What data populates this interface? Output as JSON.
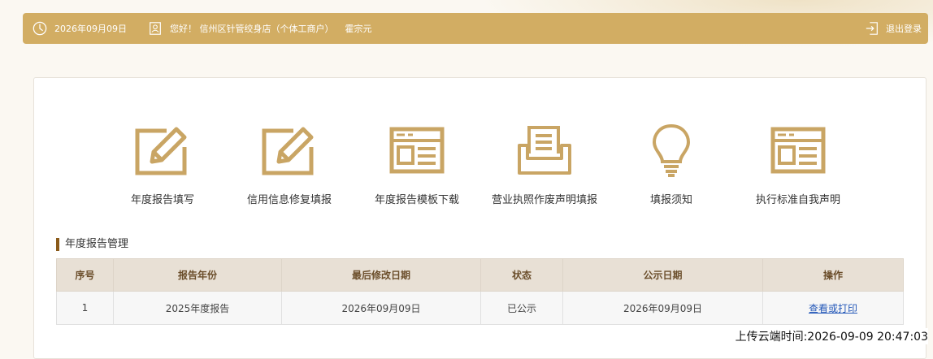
{
  "topbar": {
    "date": "2026年09月09日",
    "greeting": "您好！ 信州区针管绞身店（个体工商户）",
    "person": "霍宗元",
    "logout": "退出登录"
  },
  "menu": [
    {
      "label": "年度报告填写",
      "icon": "edit-icon"
    },
    {
      "label": "信用信息修复填报",
      "icon": "edit-icon"
    },
    {
      "label": "年度报告模板下载",
      "icon": "template-icon"
    },
    {
      "label": "营业执照作废声明填报",
      "icon": "tray-icon"
    },
    {
      "label": "填报须知",
      "icon": "lightbulb-icon"
    },
    {
      "label": "执行标准自我声明",
      "icon": "template-icon"
    }
  ],
  "section_title": "年度报告管理",
  "table": {
    "headers": [
      "序号",
      "报告年份",
      "最后修改日期",
      "状态",
      "公示日期",
      "操作"
    ],
    "rows": [
      [
        "1",
        "2025年度报告",
        "2026年09月09日",
        "已公示",
        "2026年09月09日",
        "查看或打印"
      ]
    ]
  },
  "upload_time": "上传云端时间:2026-09-09 20:47:03",
  "colors": {
    "accent": "#d2ad63",
    "icon": "#c9a564",
    "header_bg": "#e8e0d5"
  }
}
